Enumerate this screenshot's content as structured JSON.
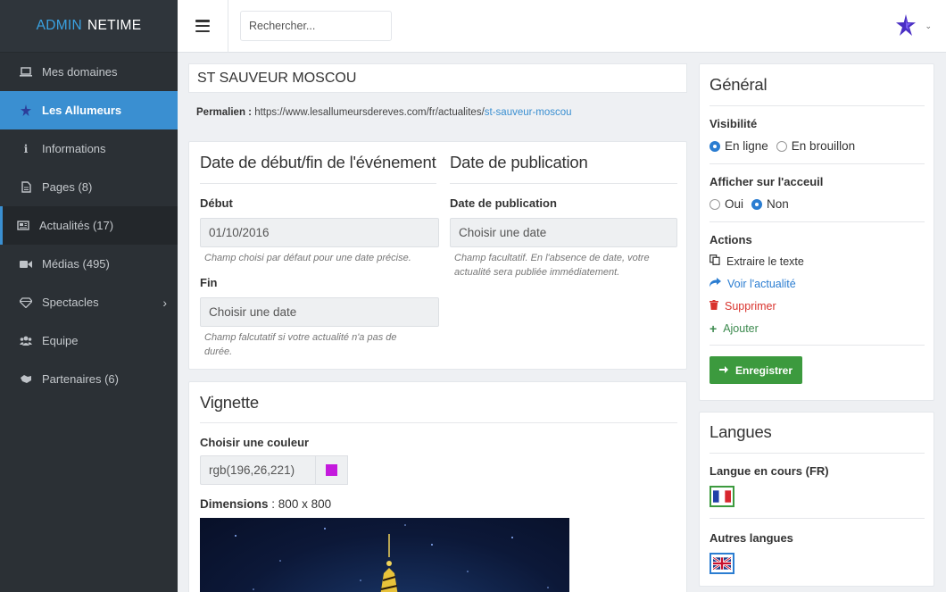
{
  "brand": {
    "part1": "ADMIN",
    "part2": "NETIME"
  },
  "sidebar": {
    "items": [
      {
        "label": "Mes domaines",
        "icon": "laptop-icon"
      },
      {
        "label": "Les Allumeurs",
        "icon": "star-icon"
      },
      {
        "label": "Informations",
        "icon": "info-icon"
      },
      {
        "label": "Pages (8)",
        "icon": "file-icon"
      },
      {
        "label": "Actualités (17)",
        "icon": "newspaper-icon"
      },
      {
        "label": "Médias (495)",
        "icon": "video-camera-icon"
      },
      {
        "label": "Spectacles",
        "icon": "diamond-icon"
      },
      {
        "label": "Equipe",
        "icon": "users-icon"
      },
      {
        "label": "Partenaires (6)",
        "icon": "handshake-icon"
      }
    ]
  },
  "topbar": {
    "search_placeholder": "Rechercher..."
  },
  "article": {
    "title": "ST SAUVEUR MOSCOU",
    "permalink_label": "Permalien :",
    "permalink_base": "https://www.lesallumeursdereves.com/fr/actualites/",
    "permalink_slug": "st-sauveur-moscou"
  },
  "dates": {
    "event_heading": "Date de début/fin de l'événement",
    "start_label": "Début",
    "start_value": "01/10/2016",
    "start_help": "Champ choisi par défaut pour une date précise.",
    "end_label": "Fin",
    "end_placeholder": "Choisir une date",
    "end_help_1": "Champ falcutatif si votre actualité n'a pas de",
    "end_help_2": "durée.",
    "pub_heading": "Date de publication",
    "pub_label": "Date de publication",
    "pub_placeholder": "Choisir une date",
    "pub_help_1": "Champ facultatif. En l'absence de date, votre",
    "pub_help_2": "actualité sera publiée immédiatement."
  },
  "vignette": {
    "heading": "Vignette",
    "color_label": "Choisir une couleur",
    "color_value": "rgb(196,26,221)",
    "swatch_color": "#c41add",
    "dimensions_label": "Dimensions",
    "dimensions_value": ": 800 x 800"
  },
  "general": {
    "heading": "Général",
    "visibility_label": "Visibilité",
    "visibility_options": [
      "En ligne",
      "En brouillon"
    ],
    "show_home_label": "Afficher sur l'acceuil",
    "show_home_options": [
      "Oui",
      "Non"
    ],
    "actions_label": "Actions",
    "actions": {
      "extract": "Extraire le texte",
      "view": "Voir l'actualité",
      "delete": "Supprimer",
      "add": "Ajouter"
    },
    "save_label": "Enregistrer"
  },
  "languages": {
    "heading": "Langues",
    "current_label": "Langue en cours (FR)",
    "others_label": "Autres langues"
  },
  "colors": {
    "accent": "#3a8fd1",
    "success": "#3c9a3e",
    "danger": "#d9332d",
    "sidebar_bg": "#2b3035"
  }
}
